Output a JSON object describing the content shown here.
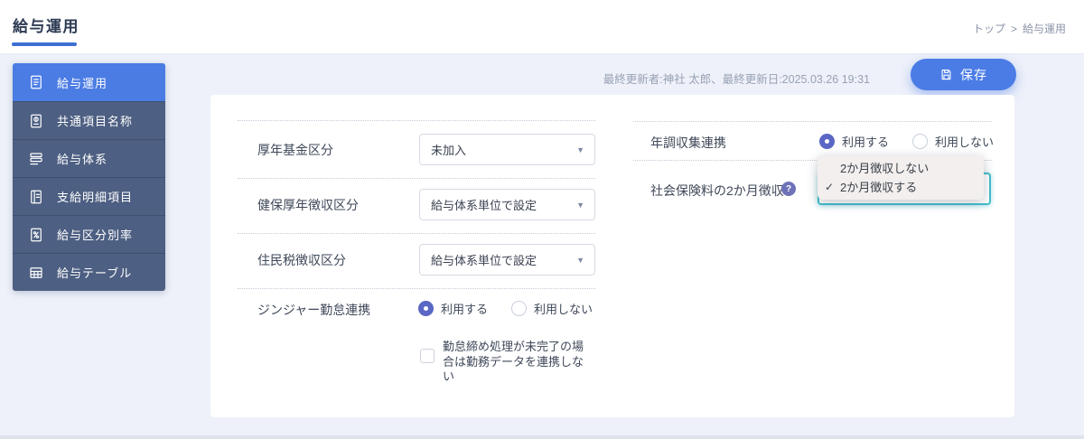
{
  "page": {
    "title": "給与運用",
    "breadcrumb": {
      "home": "トップ",
      "separator": ">",
      "current": "給与運用"
    }
  },
  "sidebar": {
    "items": [
      {
        "label": "給与運用",
        "icon": "payroll-operation-icon",
        "active": true
      },
      {
        "label": "共通項目名称",
        "icon": "common-item-names-icon",
        "active": false
      },
      {
        "label": "給与体系",
        "icon": "salary-structure-icon",
        "active": false
      },
      {
        "label": "支給明細項目",
        "icon": "payslip-items-icon",
        "active": false
      },
      {
        "label": "給与区分別率",
        "icon": "salary-category-rate-icon",
        "active": false
      },
      {
        "label": "給与テーブル",
        "icon": "salary-table-icon",
        "active": false
      }
    ]
  },
  "toolbar": {
    "last_updated": "最終更新者:神社 太郎、最終更新日:2025.03.26 19:31",
    "save_label": "保存",
    "save_icon": "floppy-disk-icon"
  },
  "form": {
    "left": {
      "pension_fund": {
        "label": "厚年基金区分",
        "value": "未加入"
      },
      "health_pension": {
        "label": "健保厚年徴収区分",
        "value": "給与体系単位で設定"
      },
      "resident_tax": {
        "label": "住民税徴収区分",
        "value": "給与体系単位で設定"
      },
      "attendance_link": {
        "label": "ジンジャー勤怠連携",
        "options": [
          "利用する",
          "利用しない"
        ],
        "selected": "利用する"
      },
      "attendance_checkbox": {
        "label": "勤怠締め処理が未完了の場合は勤務データを連携しない",
        "checked": false
      }
    },
    "right": {
      "year_end_link": {
        "label": "年調収集連携",
        "options": [
          "利用する",
          "利用しない"
        ],
        "selected": "利用する"
      },
      "two_month_collection": {
        "label": "社会保険料の2か月徴収",
        "help_icon": "question-mark-icon",
        "dropdown": {
          "options": [
            "2か月徴収しない",
            "2か月徴収する"
          ],
          "selected": "2か月徴収する"
        }
      }
    }
  },
  "icons": {
    "select_arrow": "▼",
    "checkmark": "✓",
    "question_glyph": "?"
  },
  "colors": {
    "page_bg": "#eef1f9",
    "accent_blue": "#4b7ce4",
    "sidebar_bg": "#4d5f82",
    "sidebar_active": "#4b7ce4",
    "title_underline": "#3d6ed3",
    "radio_selected": "#5a67c4",
    "focus_teal": "#43bfcd",
    "help_icon_bg": "#6e72b8",
    "dropdown_bg": "#f2efee",
    "muted_text": "#98a1b4"
  }
}
